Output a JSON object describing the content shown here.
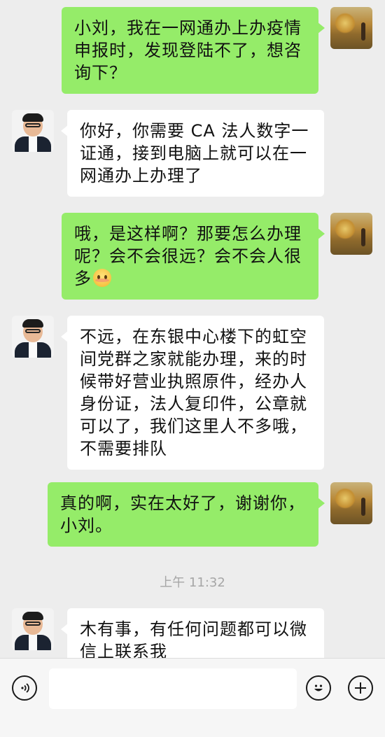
{
  "messages": [
    {
      "from": "self",
      "text": "小刘，我在一网通办上办疫情申报时，发现登陆不了，想咨询下？"
    },
    {
      "from": "other",
      "text": "你好，你需要 CA 法人数字一证通，接到电脑上就可以在一网通办上办理了"
    },
    {
      "from": "self",
      "text": "哦，是这样啊？那要怎么办理呢？会不会很远？会不会人很多",
      "emoji": "flushed-face-emoji"
    },
    {
      "from": "other",
      "text": "不远，在东银中心楼下的虹空间党群之家就能办理，来的时候带好营业执照原件，经办人身份证，法人复印件，公章就可以了，我们这里人不多哦，不需要排队"
    },
    {
      "from": "self",
      "text": "真的啊，实在太好了，谢谢你，小刘。"
    },
    {
      "from": "other",
      "text": "木有事，有任何问题都可以微信上联系我"
    }
  ],
  "timestamp": "上午 11:32",
  "colors": {
    "self_bubble": "#95ec69",
    "other_bubble": "#ffffff",
    "background": "#ededed"
  },
  "input_bar": {
    "left_icon": "voice-icon",
    "right_icons": [
      "emoji-icon",
      "plus-icon"
    ],
    "input_value": ""
  }
}
